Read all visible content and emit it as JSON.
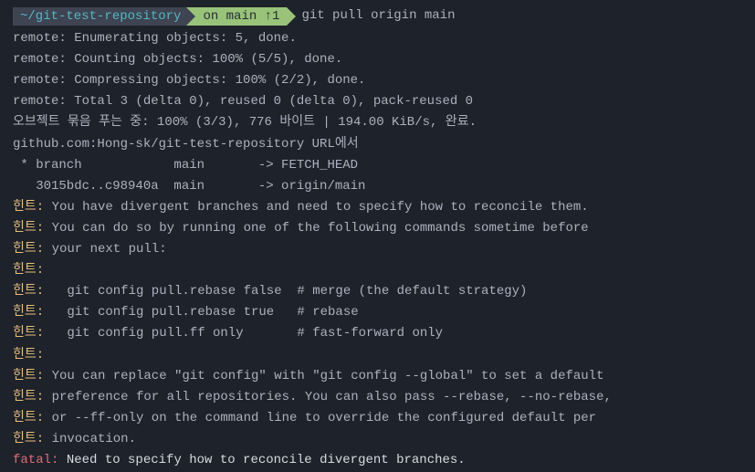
{
  "prompt": {
    "path": "~/git-test-repository",
    "branch": "on main ↑1",
    "command": "git pull origin main"
  },
  "output": {
    "l1": "remote: Enumerating objects: 5, done.",
    "l2": "remote: Counting objects: 100% (5/5), done.",
    "l3": "remote: Compressing objects: 100% (2/2), done.",
    "l4": "remote: Total 3 (delta 0), reused 0 (delta 0), pack-reused 0",
    "l5": "오브젝트 묶음 푸는 중: 100% (3/3), 776 바이트 | 194.00 KiB/s, 완료.",
    "l6": "github.com:Hong-sk/git-test-repository URL에서",
    "l7": " * branch            main       -> FETCH_HEAD",
    "l8": "   3015bdc..c98940a  main       -> origin/main"
  },
  "hint": {
    "prefix": "힌트:",
    "h1": " You have divergent branches and need to specify how to reconcile them.",
    "h2": " You can do so by running one of the following commands sometime before",
    "h3": " your next pull:",
    "h4": "",
    "h5": "   git config pull.rebase false  # merge (the default strategy)",
    "h6": "   git config pull.rebase true   # rebase",
    "h7": "   git config pull.ff only       # fast-forward only",
    "h8": "",
    "h9": " You can replace \"git config\" with \"git config --global\" to set a default",
    "h10": " preference for all repositories. You can also pass --rebase, --no-rebase,",
    "h11": " or --ff-only on the command line to override the configured default per",
    "h12": " invocation."
  },
  "fatal": {
    "prefix": "fatal:",
    "msg": " Need to specify how to reconcile divergent branches."
  }
}
